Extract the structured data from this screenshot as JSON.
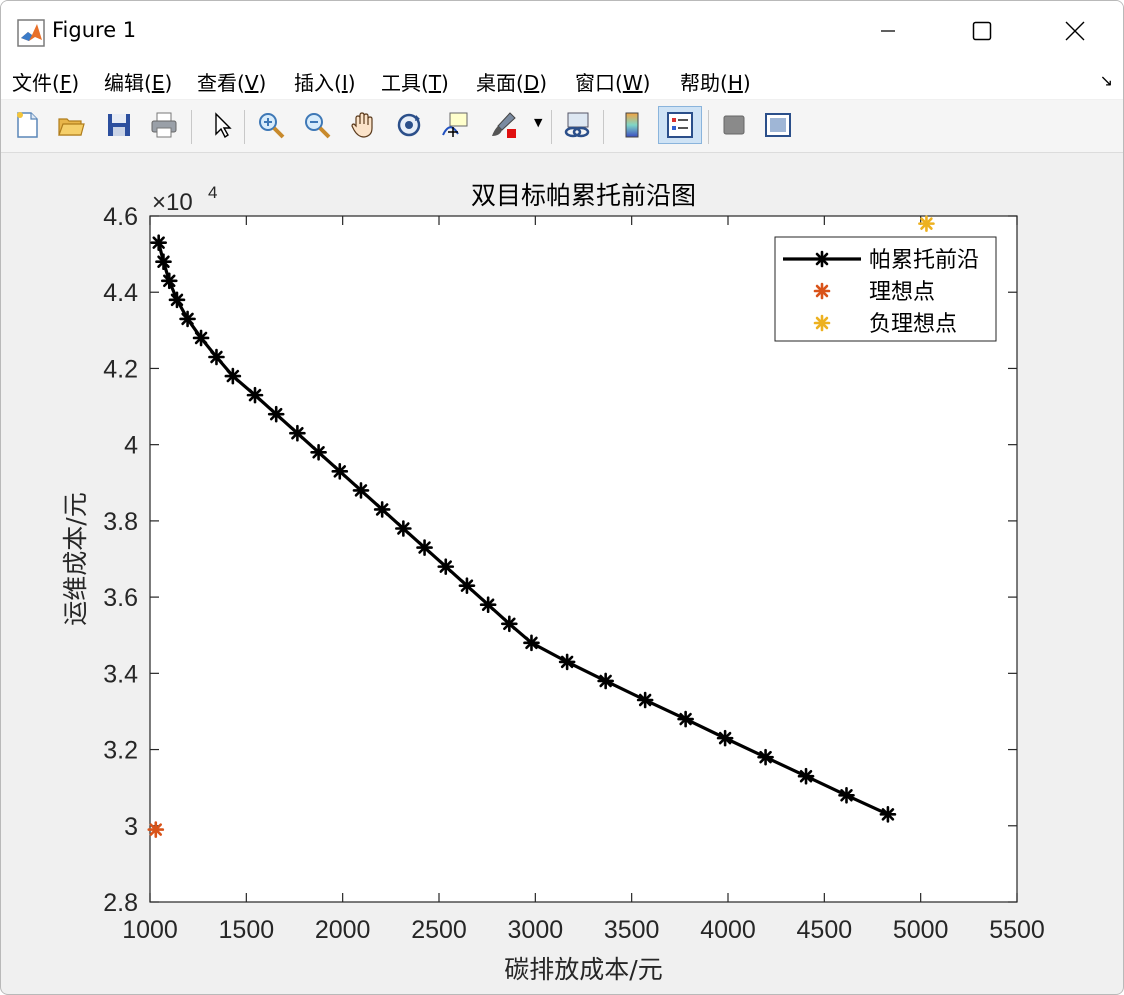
{
  "window": {
    "title": "Figure 1"
  },
  "menu": [
    {
      "label": "文件(",
      "key": "F",
      "tail": ")"
    },
    {
      "label": "编辑(",
      "key": "E",
      "tail": ")"
    },
    {
      "label": "查看(",
      "key": "V",
      "tail": ")"
    },
    {
      "label": "插入(",
      "key": "I",
      "tail": ")"
    },
    {
      "label": "工具(",
      "key": "T",
      "tail": ")"
    },
    {
      "label": "桌面(",
      "key": "D",
      "tail": ")"
    },
    {
      "label": "窗口(",
      "key": "W",
      "tail": ")"
    },
    {
      "label": "帮助(",
      "key": "H",
      "tail": ")"
    }
  ],
  "colors": {
    "front": "#000000",
    "ideal": "#d95319",
    "nadir": "#edb120"
  },
  "chart_data": {
    "type": "line",
    "title": "双目标帕累托前沿图",
    "xlabel": "碳排放成本/元",
    "ylabel": "运维成本/元",
    "exponent_label": "×10",
    "exponent_power": "4",
    "xlim": [
      1000,
      5500
    ],
    "ylim": [
      28000,
      46000
    ],
    "xticks": [
      1000,
      1500,
      2000,
      2500,
      3000,
      3500,
      4000,
      4500,
      5000,
      5500
    ],
    "xtick_labels": [
      "1000",
      "1500",
      "2000",
      "2500",
      "3000",
      "3500",
      "4000",
      "4500",
      "5000",
      "5500"
    ],
    "yticks": [
      28000,
      30000,
      32000,
      34000,
      36000,
      38000,
      40000,
      42000,
      44000,
      46000
    ],
    "ytick_labels": [
      "2.8",
      "3",
      "3.2",
      "3.4",
      "3.6",
      "3.8",
      "4",
      "4.2",
      "4.4",
      "4.6"
    ],
    "grid": false,
    "legend_position": "top-right",
    "series": [
      {
        "name": "帕累托前沿",
        "x": [
          1045,
          1070,
          1100,
          1140,
          1195,
          1265,
          1345,
          1430,
          1545,
          1655,
          1765,
          1875,
          1985,
          2095,
          2205,
          2315,
          2425,
          2535,
          2645,
          2755,
          2865,
          2980,
          3165,
          3365,
          3570,
          3780,
          3985,
          4195,
          4405,
          4615,
          4830
        ],
        "y": [
          45300,
          44800,
          44300,
          43800,
          43300,
          42800,
          42300,
          41800,
          41300,
          40800,
          40300,
          39800,
          39300,
          38800,
          38300,
          37800,
          37300,
          36800,
          36300,
          35800,
          35300,
          34800,
          34300,
          33800,
          33300,
          32800,
          32300,
          31800,
          31300,
          30800,
          30300
        ]
      },
      {
        "name": "理想点",
        "x": [
          1030
        ],
        "y": [
          29900
        ]
      },
      {
        "name": "负理想点",
        "x": [
          5030
        ],
        "y": [
          45800
        ]
      }
    ]
  }
}
